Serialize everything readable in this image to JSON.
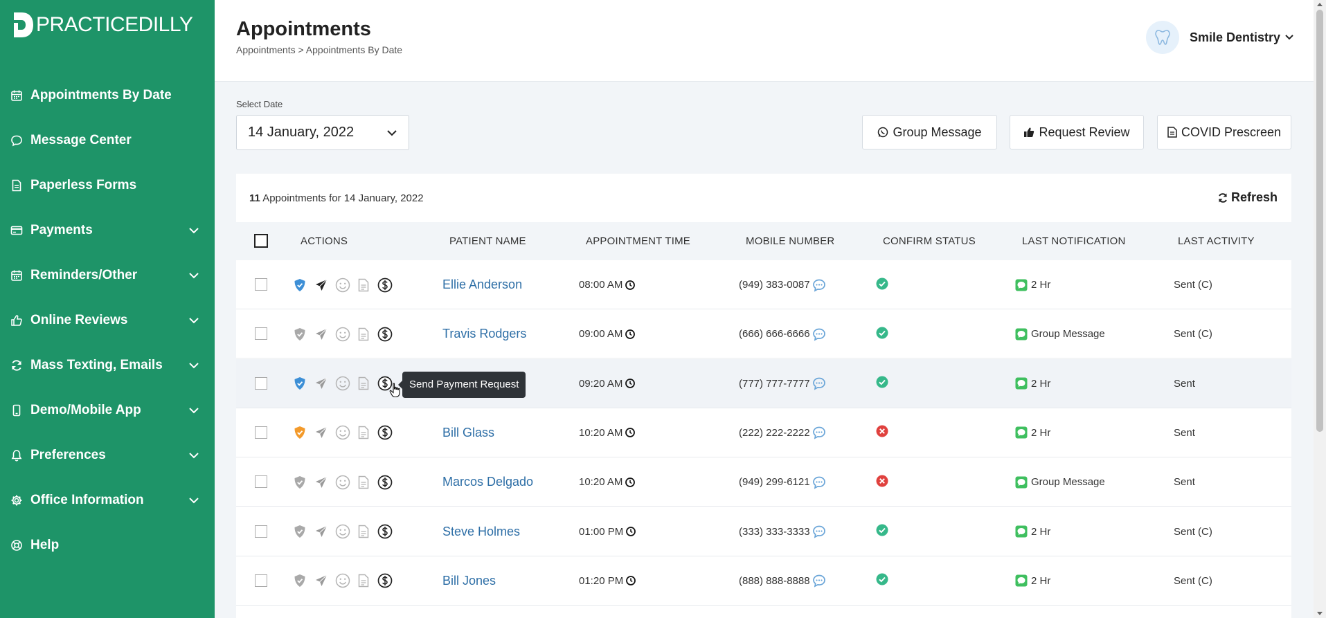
{
  "brand": {
    "logo_text": "PRACTICEDILLY",
    "primary_color": "#1e9468"
  },
  "sidebar": {
    "items": [
      {
        "label": "Appointments By Date",
        "icon": "calendar-icon",
        "expandable": false
      },
      {
        "label": "Message Center",
        "icon": "chat-icon",
        "expandable": false
      },
      {
        "label": "Paperless Forms",
        "icon": "document-icon",
        "expandable": false
      },
      {
        "label": "Payments",
        "icon": "credit-card-icon",
        "expandable": true
      },
      {
        "label": "Reminders/Other",
        "icon": "calendar-icon",
        "expandable": true
      },
      {
        "label": "Online Reviews",
        "icon": "thumbs-up-icon",
        "expandable": true
      },
      {
        "label": "Mass Texting, Emails",
        "icon": "sync-icon",
        "expandable": true
      },
      {
        "label": "Demo/Mobile App",
        "icon": "mobile-icon",
        "expandable": true
      },
      {
        "label": "Preferences",
        "icon": "bell-icon",
        "expandable": true
      },
      {
        "label": "Office Information",
        "icon": "gear-icon",
        "expandable": true
      },
      {
        "label": "Help",
        "icon": "lifebuoy-icon",
        "expandable": false
      }
    ]
  },
  "header": {
    "title": "Appointments",
    "breadcrumb": "Appointments > Appointments By Date",
    "practice_name": "Smile Dentistry"
  },
  "toolbar": {
    "date_label": "Select Date",
    "date_value": "14 January, 2022",
    "group_message": "Group Message",
    "request_review": "Request Review",
    "covid_prescreen": "COVID Prescreen"
  },
  "summary": {
    "count": "11",
    "text": " Appointments for 14 January, 2022",
    "refresh": "Refresh"
  },
  "table": {
    "headers": [
      "ACTIONS",
      "PATIENT NAME",
      "APPOINTMENT TIME",
      "MOBILE NUMBER",
      "CONFIRM STATUS",
      "LAST NOTIFICATION",
      "LAST ACTIVITY"
    ],
    "rows": [
      {
        "shield": "blue",
        "send_active": true,
        "patient": "Ellie Anderson",
        "time": "08:00 AM",
        "mobile": "(949) 383-0087",
        "confirm": "confirmed",
        "notification": "2 Hr",
        "activity": "Sent (C)"
      },
      {
        "shield": "gray",
        "send_active": false,
        "patient": "Travis Rodgers",
        "time": "09:00 AM",
        "mobile": "(666) 666-6666",
        "confirm": "confirmed",
        "notification": "Group Message",
        "activity": "Sent (C)"
      },
      {
        "shield": "blue",
        "send_active": false,
        "patient": "",
        "time": "09:20 AM",
        "mobile": "(777) 777-7777",
        "confirm": "confirmed",
        "notification": "2 Hr",
        "activity": "Sent"
      },
      {
        "shield": "orange",
        "send_active": false,
        "patient": "Bill Glass",
        "time": "10:20 AM",
        "mobile": "(222) 222-2222",
        "confirm": "declined",
        "notification": "2 Hr",
        "activity": "Sent"
      },
      {
        "shield": "gray",
        "send_active": false,
        "patient": "Marcos Delgado",
        "time": "10:20 AM",
        "mobile": "(949) 299-6121",
        "confirm": "declined",
        "notification": "Group Message",
        "activity": "Sent"
      },
      {
        "shield": "gray",
        "send_active": false,
        "patient": "Steve Holmes",
        "time": "01:00 PM",
        "mobile": "(333) 333-3333",
        "confirm": "confirmed",
        "notification": "2 Hr",
        "activity": "Sent (C)"
      },
      {
        "shield": "gray",
        "send_active": false,
        "patient": "Bill Jones",
        "time": "01:20 PM",
        "mobile": "(888) 888-8888",
        "confirm": "confirmed",
        "notification": "2 Hr",
        "activity": "Sent (C)"
      }
    ]
  },
  "tooltip": {
    "text": "Send Payment Request"
  },
  "colors": {
    "shield_blue": "#3d8fd6",
    "shield_orange": "#f39a2b",
    "shield_gray": "#a9a9a9",
    "confirm_green": "#36b88a",
    "decline_red": "#e0413e",
    "sms_green": "#3fbf5f",
    "link_blue": "#2d6ea6"
  }
}
